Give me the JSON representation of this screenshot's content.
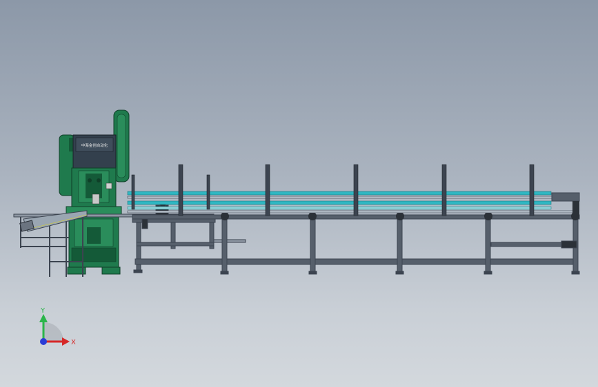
{
  "viewport": {
    "background_top": "#8c98a8",
    "background_bottom": "#d3d8dd"
  },
  "press": {
    "nameplate_text": "中海金创自动化",
    "body_color": "#1f7a4d",
    "body_dark": "#0f4f30",
    "panel_color": "#33404d"
  },
  "conveyor": {
    "rail_color": "#2fb7c2",
    "frame_color": "#3c4450"
  },
  "triad": {
    "x_label": "X",
    "y_label": "Y",
    "x_color": "#d62828",
    "y_color": "#2bb54a",
    "origin_color": "#2a3cd6"
  }
}
